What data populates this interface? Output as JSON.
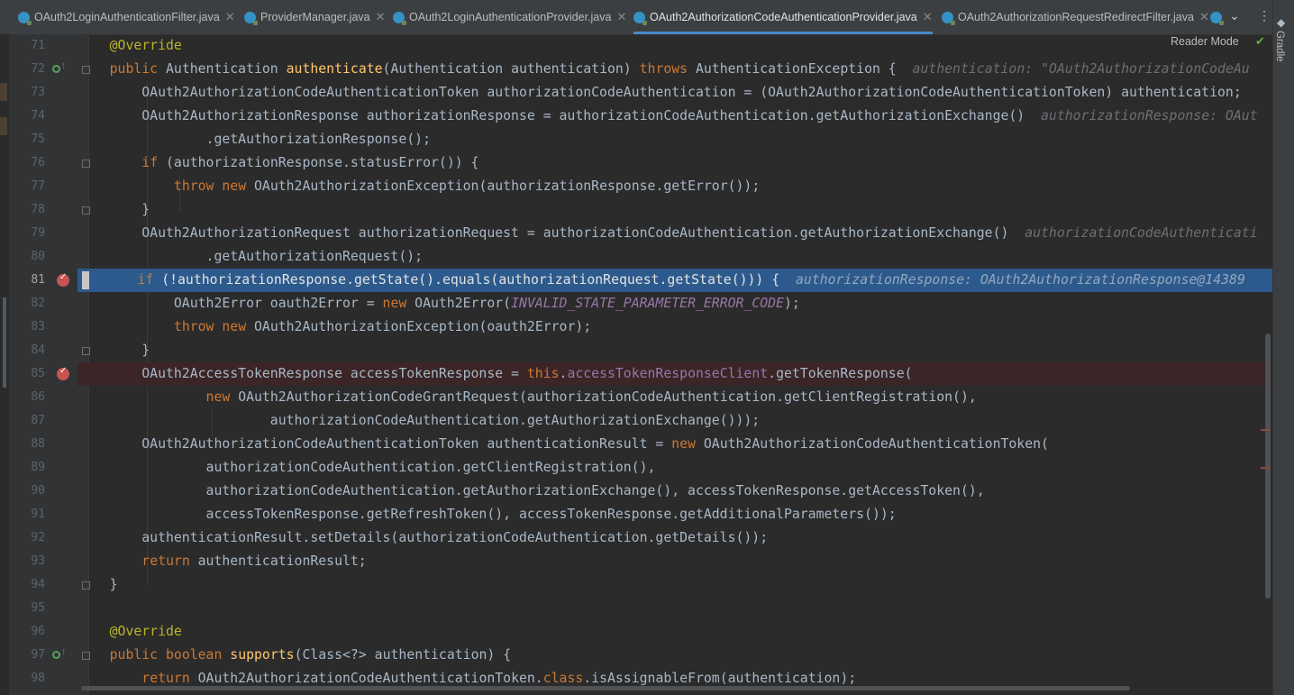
{
  "tabs": [
    {
      "label": "OAuth2LoginAuthenticationFilter.java",
      "active": false
    },
    {
      "label": "ProviderManager.java",
      "active": false
    },
    {
      "label": "OAuth2LoginAuthenticationProvider.java",
      "active": false
    },
    {
      "label": "OAuth2AuthorizationCodeAuthenticationProvider.java",
      "active": true
    },
    {
      "label": "OAuth2AuthorizationRequestRedirectFilter.java",
      "active": false
    }
  ],
  "reader_mode_label": "Reader Mode",
  "gradle_label": "Gradle",
  "icons": {
    "close": "close-icon",
    "chevron": "chevron-down-icon",
    "more": "more-vertical-icon",
    "breakpoint": "breakpoint-icon",
    "override": "override-method-icon",
    "check": "check-icon"
  },
  "colors": {
    "keyword": "#cc7832",
    "annotation": "#bbb529",
    "method": "#ffc66d",
    "constant": "#9876aa",
    "execution_line": "#2d5a8c",
    "breakpoint": "#c75450"
  },
  "current_execution_line": 81,
  "breakpoint_lines": [
    81,
    85
  ],
  "lines": [
    {
      "n": "71",
      "code": "    @Override"
    },
    {
      "n": "72",
      "code": "    public Authentication authenticate(Authentication authentication) throws AuthenticationException {",
      "hint": "authentication: \"OAuth2AuthorizationCodeAu"
    },
    {
      "n": "73",
      "code": "        OAuth2AuthorizationCodeAuthenticationToken authorizationCodeAuthentication = (OAuth2AuthorizationCodeAuthenticationToken) authentication;"
    },
    {
      "n": "74",
      "code": "        OAuth2AuthorizationResponse authorizationResponse = authorizationCodeAuthentication.getAuthorizationExchange()",
      "hint": "authorizationResponse: OAut"
    },
    {
      "n": "75",
      "code": "                .getAuthorizationResponse();"
    },
    {
      "n": "76",
      "code": "        if (authorizationResponse.statusError()) {"
    },
    {
      "n": "77",
      "code": "            throw new OAuth2AuthorizationException(authorizationResponse.getError());"
    },
    {
      "n": "78",
      "code": "        }"
    },
    {
      "n": "79",
      "code": "        OAuth2AuthorizationRequest authorizationRequest = authorizationCodeAuthentication.getAuthorizationExchange()",
      "hint": "authorizationCodeAuthenticati"
    },
    {
      "n": "80",
      "code": "                .getAuthorizationRequest();"
    },
    {
      "n": "81",
      "code": "        if (!authorizationResponse.getState().equals(authorizationRequest.getState())) {",
      "hint": "authorizationResponse: OAuth2AuthorizationResponse@14389"
    },
    {
      "n": "82",
      "code": "            OAuth2Error oauth2Error = new OAuth2Error(INVALID_STATE_PARAMETER_ERROR_CODE);"
    },
    {
      "n": "83",
      "code": "            throw new OAuth2AuthorizationException(oauth2Error);"
    },
    {
      "n": "84",
      "code": "        }"
    },
    {
      "n": "85",
      "code": "        OAuth2AccessTokenResponse accessTokenResponse = this.accessTokenResponseClient.getTokenResponse("
    },
    {
      "n": "86",
      "code": "                new OAuth2AuthorizationCodeGrantRequest(authorizationCodeAuthentication.getClientRegistration(),"
    },
    {
      "n": "87",
      "code": "                        authorizationCodeAuthentication.getAuthorizationExchange()));"
    },
    {
      "n": "88",
      "code": "        OAuth2AuthorizationCodeAuthenticationToken authenticationResult = new OAuth2AuthorizationCodeAuthenticationToken("
    },
    {
      "n": "89",
      "code": "                authorizationCodeAuthentication.getClientRegistration(),"
    },
    {
      "n": "90",
      "code": "                authorizationCodeAuthentication.getAuthorizationExchange(), accessTokenResponse.getAccessToken(),"
    },
    {
      "n": "91",
      "code": "                accessTokenResponse.getRefreshToken(), accessTokenResponse.getAdditionalParameters());"
    },
    {
      "n": "92",
      "code": "        authenticationResult.setDetails(authorizationCodeAuthentication.getDetails());"
    },
    {
      "n": "93",
      "code": "        return authenticationResult;"
    },
    {
      "n": "94",
      "code": "    }"
    },
    {
      "n": "95",
      "code": ""
    },
    {
      "n": "96",
      "code": "    @Override"
    },
    {
      "n": "97",
      "code": "    public boolean supports(Class<?> authentication) {"
    },
    {
      "n": "98",
      "code": "        return OAuth2AuthorizationCodeAuthenticationToken.class.isAssignableFrom(authentication);"
    }
  ]
}
